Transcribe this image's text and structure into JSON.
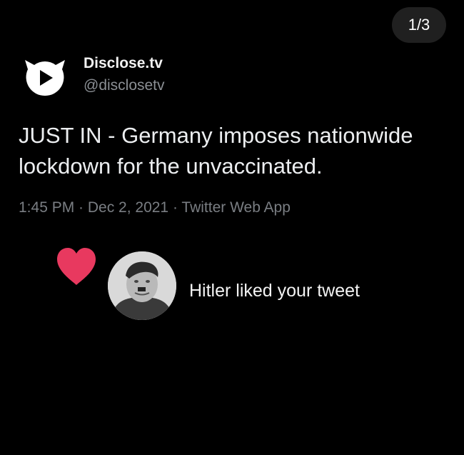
{
  "page_counter": "1/3",
  "account": {
    "name": "Disclose.tv",
    "handle": "@disclosetv",
    "avatar_icon": "disclose-play-logo-icon"
  },
  "tweet": {
    "text": "JUST IN - Germany imposes nationwide lockdown for the unvaccinated.",
    "meta": "1:45 PM · Dec 2, 2021 · Twitter Web App"
  },
  "notification": {
    "icon": "heart-icon",
    "heart_color": "#e8395f",
    "text": "Hitler liked your tweet"
  },
  "colors": {
    "background": "#000000",
    "counter_bg": "#202020",
    "handle": "#8b8f94",
    "meta": "#7a7e83"
  }
}
